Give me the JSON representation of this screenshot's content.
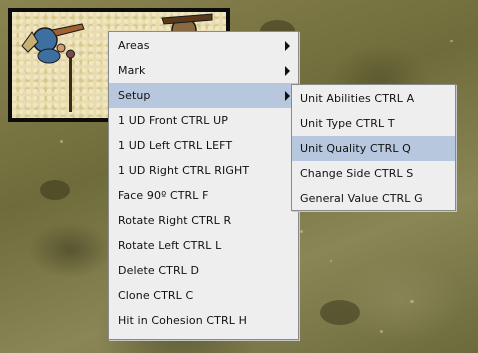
{
  "context_menu": {
    "items": [
      {
        "label": "Areas",
        "has_submenu": true
      },
      {
        "label": "Mark",
        "has_submenu": true
      },
      {
        "label": "Setup",
        "has_submenu": true,
        "selected": true
      },
      {
        "label": "1 UD Front  CTRL UP"
      },
      {
        "label": "1 UD Left  CTRL LEFT"
      },
      {
        "label": "1 UD Right  CTRL RIGHT"
      },
      {
        "label": "Face 90º  CTRL F"
      },
      {
        "label": "Rotate Right  CTRL R"
      },
      {
        "label": "Rotate Left  CTRL L"
      },
      {
        "label": "Delete  CTRL D"
      },
      {
        "label": "Clone  CTRL C"
      },
      {
        "label": "Hit in Cohesion  CTRL H"
      }
    ]
  },
  "setup_submenu": {
    "items": [
      {
        "label": "Unit Abilities  CTRL A"
      },
      {
        "label": "Unit Type  CTRL T"
      },
      {
        "label": "Unit Quality  CTRL Q",
        "selected": true
      },
      {
        "label": "Change Side  CTRL S"
      },
      {
        "label": "General Value  CTRL G"
      }
    ]
  },
  "colors": {
    "menu_background": "#eeeeee",
    "selection_highlight": "#b7c7de",
    "unit_border": "#0c0c0c",
    "terrain": "#7f7a48"
  },
  "icons": {
    "submenu_arrow": "triangle-right-icon",
    "unit_figures": "soldier-figure-icon"
  }
}
